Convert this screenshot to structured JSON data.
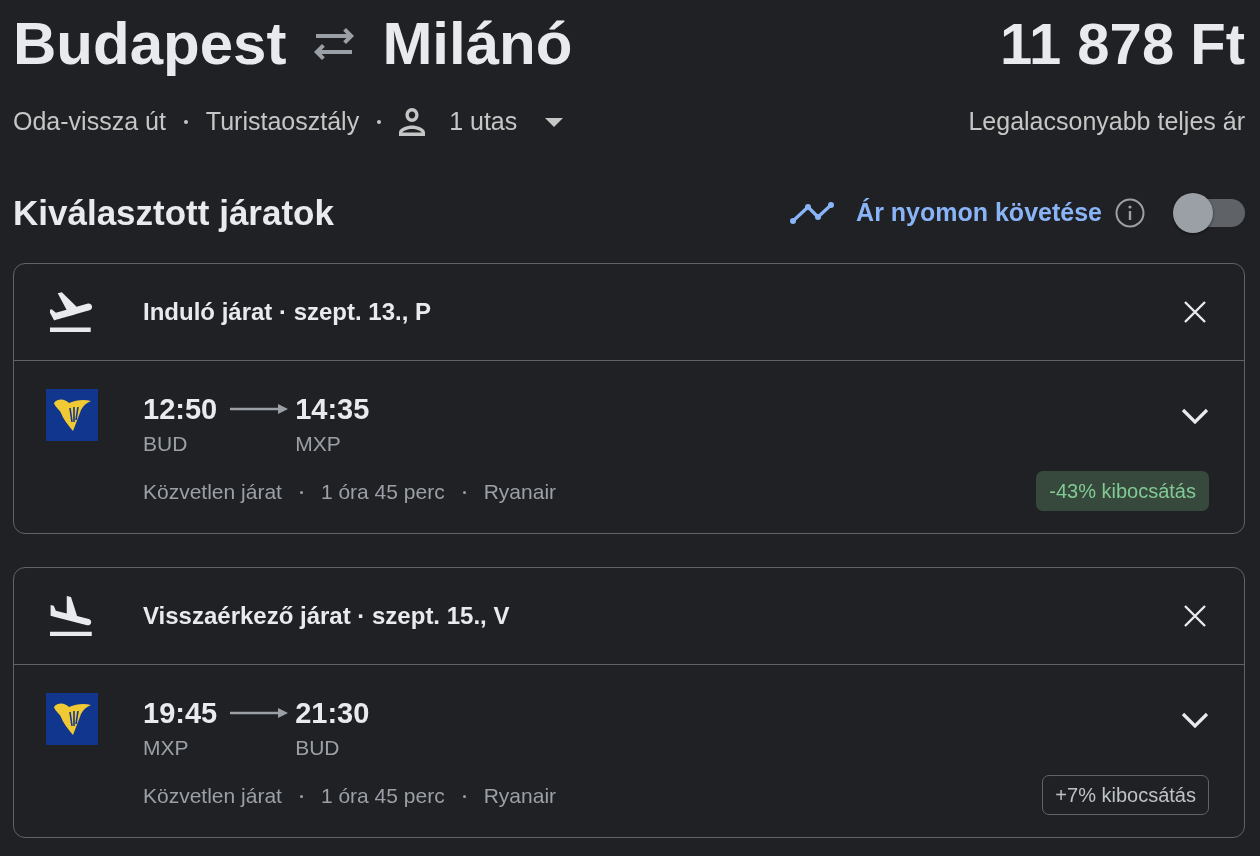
{
  "route": {
    "origin": "Budapest",
    "destination": "Milánó"
  },
  "price": "11 878 Ft",
  "trip": {
    "type": "Oda-vissza út",
    "cabin": "Turistaosztály",
    "passengers": "1 utas"
  },
  "price_note": "Legalacsonyabb teljes ár",
  "selected_flights": {
    "title": "Kiválasztott járatok",
    "price_tracking": {
      "label": "Ár nyomon követése",
      "on": false
    },
    "flights": [
      {
        "kind": "departure",
        "heading": "Induló járat · szept. 13., P",
        "departure_time": "12:50",
        "arrival_time": "14:35",
        "departure_airport": "BUD",
        "arrival_airport": "MXP",
        "details": [
          "Közvetlen járat",
          "1 óra 45 perc",
          "Ryanair"
        ],
        "expanded": false,
        "emissions": {
          "label": "-43% kibocsátás",
          "kind": "lower"
        }
      },
      {
        "kind": "return",
        "heading": "Visszaérkező járat · szept. 15., V",
        "departure_time": "19:45",
        "arrival_time": "21:30",
        "departure_airport": "MXP",
        "arrival_airport": "BUD",
        "details": [
          "Közvetlen járat",
          "1 óra 45 perc",
          "Ryanair"
        ],
        "expanded": false,
        "emissions": {
          "label": "+7% kibocsátás",
          "kind": "higher"
        }
      }
    ]
  }
}
